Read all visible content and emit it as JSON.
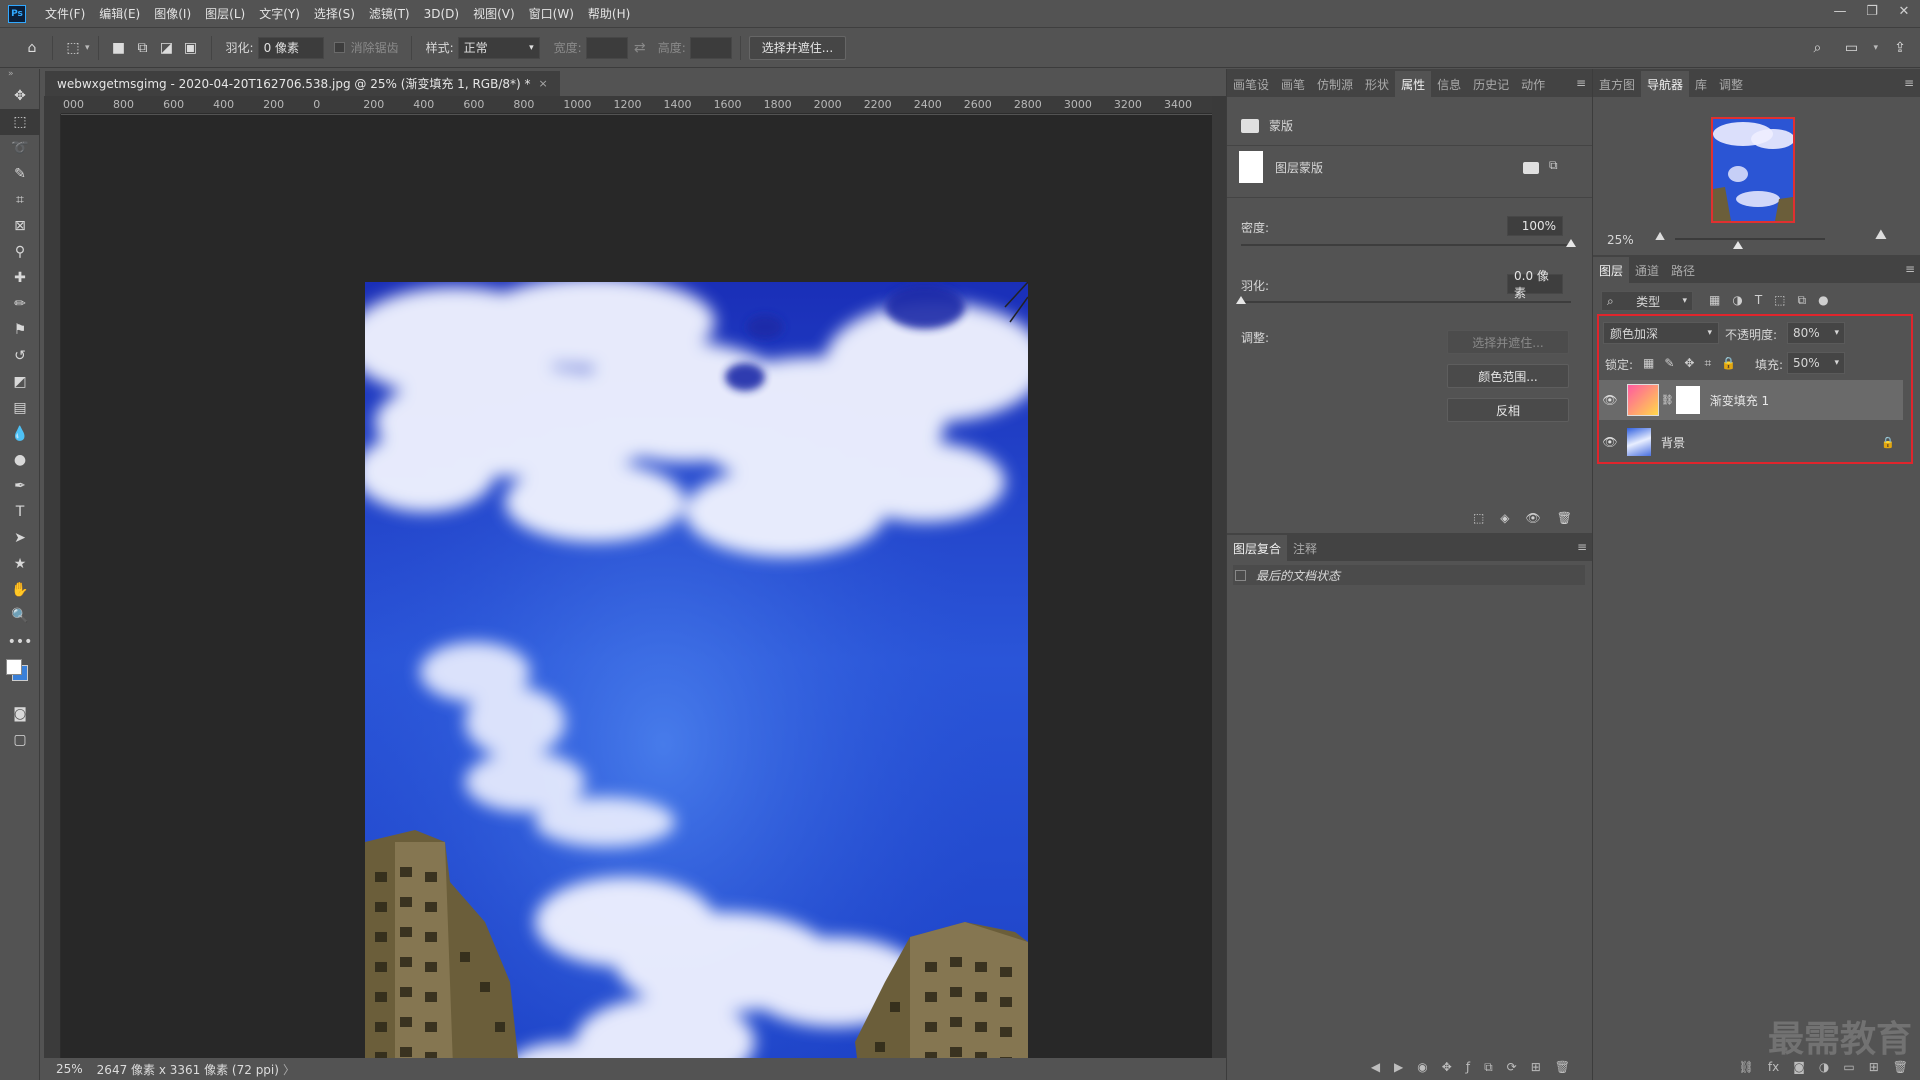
{
  "app": {
    "logo": "Ps",
    "menus": [
      "文件(F)",
      "编辑(E)",
      "图像(I)",
      "图层(L)",
      "文字(Y)",
      "选择(S)",
      "滤镜(T)",
      "3D(D)",
      "视图(V)",
      "窗口(W)",
      "帮助(H)"
    ],
    "window_controls": [
      "—",
      "❐",
      "✕"
    ]
  },
  "options": {
    "feather_label": "羽化:",
    "feather_value": "0 像素",
    "antialias_label": "消除锯齿",
    "style_label": "样式:",
    "style_value": "正常",
    "width_label": "宽度:",
    "height_label": "高度:",
    "select_mask_button": "选择并遮住..."
  },
  "document": {
    "tab_title": "webwxgetmsgimg - 2020-04-20T162706.538.jpg @ 25% (渐变填充 1, RGB/8*) *",
    "close": "×",
    "ruler_h": [
      "000",
      "800",
      "600",
      "400",
      "200",
      "0",
      "200",
      "400",
      "600",
      "800",
      "1000",
      "1200",
      "1400",
      "1600",
      "1800",
      "2000",
      "2200",
      "2400",
      "2600",
      "2800",
      "3000",
      "3200",
      "3400"
    ],
    "zoom": "25%",
    "doc_info": "2647 像素 x 3361 像素 (72 ppi)",
    "status_arrow": "〉"
  },
  "mid_panel": {
    "tabs": [
      "画笔设",
      "画笔",
      "仿制源",
      "形状",
      "属性",
      "信息",
      "历史记",
      "动作"
    ],
    "active_tab": "属性",
    "mask_header": "蒙版",
    "layer_mask_label": "图层蒙版",
    "density_label": "密度:",
    "density_value": "100%",
    "density_level": 1.0,
    "feather_label": "羽化:",
    "feather_value": "0.0 像素",
    "feather_level": 0.0,
    "adjust_label": "调整:",
    "buttons": [
      "选择并遮住...",
      "颜色范围...",
      "反相"
    ],
    "comp_tabs": [
      "图层复合",
      "注释"
    ],
    "comp_item": "最后的文档状态"
  },
  "right_panel": {
    "top_tabs": [
      "直方图",
      "导航器",
      "库",
      "调整"
    ],
    "active_top_tab": "导航器",
    "nav_zoom": "25%",
    "nav_zoom_level": 0.42,
    "layer_tabs": [
      "图层",
      "通道",
      "路径"
    ],
    "active_layer_tab": "图层",
    "filter_kind": "类型",
    "blend_mode": "颜色加深",
    "opacity_label": "不透明度:",
    "opacity_value": "80%",
    "lock_label": "锁定:",
    "fill_label": "填充:",
    "fill_value": "50%",
    "layers": [
      {
        "name": "渐变填充 1",
        "selected": true
      },
      {
        "name": "背景",
        "selected": false,
        "locked": true
      }
    ]
  },
  "watermark": "最需教育",
  "colors": {
    "highlight_box": "#e0252c",
    "gradient_thumb_a": "#ff5aa0",
    "gradient_thumb_b": "#ffd84a"
  }
}
